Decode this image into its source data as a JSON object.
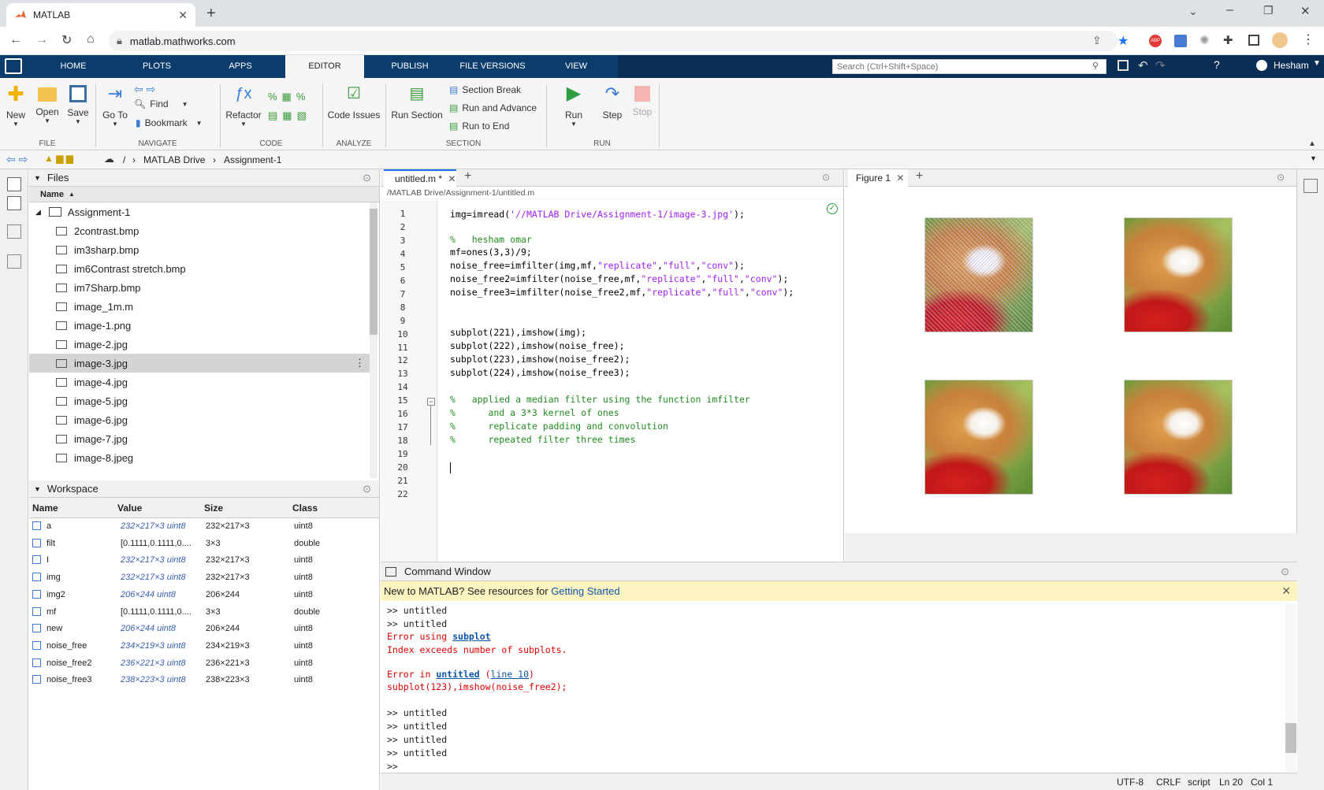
{
  "browser": {
    "tab_title": "MATLAB",
    "url": "matlab.mathworks.com"
  },
  "matlab": {
    "tabs": [
      "HOME",
      "PLOTS",
      "APPS",
      "EDITOR",
      "PUBLISH",
      "FILE VERSIONS",
      "VIEW"
    ],
    "active_tab": "EDITOR",
    "search_placeholder": "Search (Ctrl+Shift+Space)",
    "user": "Hesham",
    "ribbon": {
      "new": "New",
      "open": "Open",
      "save": "Save",
      "file_group": "FILE",
      "goto": "Go To",
      "find": "Find",
      "bookmark": "Bookmark",
      "navigate_group": "NAVIGATE",
      "refactor": "Refactor",
      "code_group": "CODE",
      "code_issues": "Code Issues",
      "analyze_group": "ANALYZE",
      "run_section": "Run Section",
      "section_break": "Section Break",
      "run_advance": "Run and Advance",
      "run_end": "Run to End",
      "section_group": "SECTION",
      "run": "Run",
      "step": "Step",
      "stop": "Stop",
      "run_group": "RUN"
    },
    "path": {
      "sep": "/",
      "drive": "MATLAB Drive",
      "folder": "Assignment-1"
    }
  },
  "files": {
    "title": "Files",
    "col_name": "Name",
    "folder": "Assignment-1",
    "items": [
      "2contrast.bmp",
      "im3sharp.bmp",
      "im6Contrast stretch.bmp",
      "im7Sharp.bmp",
      "image_1m.m",
      "image-1.png",
      "image-2.jpg",
      "image-3.jpg",
      "image-4.jpg",
      "image-5.jpg",
      "image-6.jpg",
      "image-7.jpg",
      "image-8.jpeg"
    ],
    "selected": "image-3.jpg"
  },
  "workspace": {
    "title": "Workspace",
    "cols": [
      "Name",
      "Value",
      "Size",
      "Class"
    ],
    "rows": [
      {
        "name": "a",
        "value": "232×217×3 uint8",
        "size": "232×217×3",
        "class": "uint8"
      },
      {
        "name": "filt",
        "value": "[0.1111,0.1111,0....",
        "size": "3×3",
        "class": "double"
      },
      {
        "name": "I",
        "value": "232×217×3 uint8",
        "size": "232×217×3",
        "class": "uint8"
      },
      {
        "name": "img",
        "value": "232×217×3 uint8",
        "size": "232×217×3",
        "class": "uint8"
      },
      {
        "name": "img2",
        "value": "206×244 uint8",
        "size": "206×244",
        "class": "uint8"
      },
      {
        "name": "mf",
        "value": "[0.1111,0.1111,0....",
        "size": "3×3",
        "class": "double"
      },
      {
        "name": "new",
        "value": "206×244 uint8",
        "size": "206×244",
        "class": "uint8"
      },
      {
        "name": "noise_free",
        "value": "234×219×3 uint8",
        "size": "234×219×3",
        "class": "uint8"
      },
      {
        "name": "noise_free2",
        "value": "236×221×3 uint8",
        "size": "236×221×3",
        "class": "uint8"
      },
      {
        "name": "noise_free3",
        "value": "238×223×3 uint8",
        "size": "238×223×3",
        "class": "uint8"
      }
    ]
  },
  "editor": {
    "tab": "untitled.m *",
    "path": "/MATLAB Drive/Assignment-1/untitled.m",
    "lines": [
      "1",
      "2",
      "3",
      "4",
      "5",
      "6",
      "7",
      "8",
      "9",
      "10",
      "11",
      "12",
      "13",
      "14",
      "15",
      "16",
      "17",
      "18",
      "19",
      "20",
      "21",
      "22"
    ],
    "l1a": "img=imread(",
    "l1b": "'//MATLAB Drive/Assignment-1/image-3.jpg'",
    "l1c": ");",
    "l3": "%   hesham omar",
    "l4": "mf=ones(3,3)/9;",
    "l5a": "noise_free=imfilter(img,mf,",
    "l5b": "\"replicate\"",
    "l5c": ",",
    "l5d": "\"full\"",
    "l5e": ",",
    "l5f": "\"conv\"",
    "l5g": ");",
    "l6a": "noise_free2=imfilter(noise_free,mf,",
    "l6b": "\"replicate\"",
    "l6c": ",",
    "l6d": "\"full\"",
    "l6e": ",",
    "l6f": "\"conv\"",
    "l6g": ");",
    "l7a": "noise_free3=imfilter(noise_free2,mf,",
    "l7b": "\"replicate\"",
    "l7c": ",",
    "l7d": "\"full\"",
    "l7e": ",",
    "l7f": "\"conv\"",
    "l7g": ");",
    "l10": "subplot(221),imshow(img);",
    "l11": "subplot(222),imshow(noise_free);",
    "l12": "subplot(223),imshow(noise_free2);",
    "l13": "subplot(224),imshow(noise_free3);",
    "l15": "%   applied a median filter using the function imfilter",
    "l16": "%      and a 3*3 kernel of ones",
    "l17": "%      replicate padding and convolution",
    "l18": "%      repeated filter three times"
  },
  "figure": {
    "tab": "Figure 1"
  },
  "command": {
    "title": "Command Window",
    "banner_a": "New to MATLAB? See resources for ",
    "banner_link": "Getting Started",
    "c1": ">> untitled",
    "c2": ">> untitled",
    "e1a": "Error using ",
    "e1b": "subplot",
    "e2": "Index exceeds number of subplots.",
    "e3a": "Error in ",
    "e3b": "untitled",
    "e3c": " (",
    "e3d": "line 10",
    "e3e": ")",
    "e4": "subplot(123),imshow(noise_free2);",
    "c3": ">> untitled",
    "c4": ">> untitled",
    "c5": ">> untitled",
    "c6": ">> untitled",
    "prompt": ">>"
  },
  "status": {
    "enc": "UTF-8",
    "eol": "CRLF",
    "type": "script",
    "ln": "Ln 20",
    "col": "Col 1"
  }
}
